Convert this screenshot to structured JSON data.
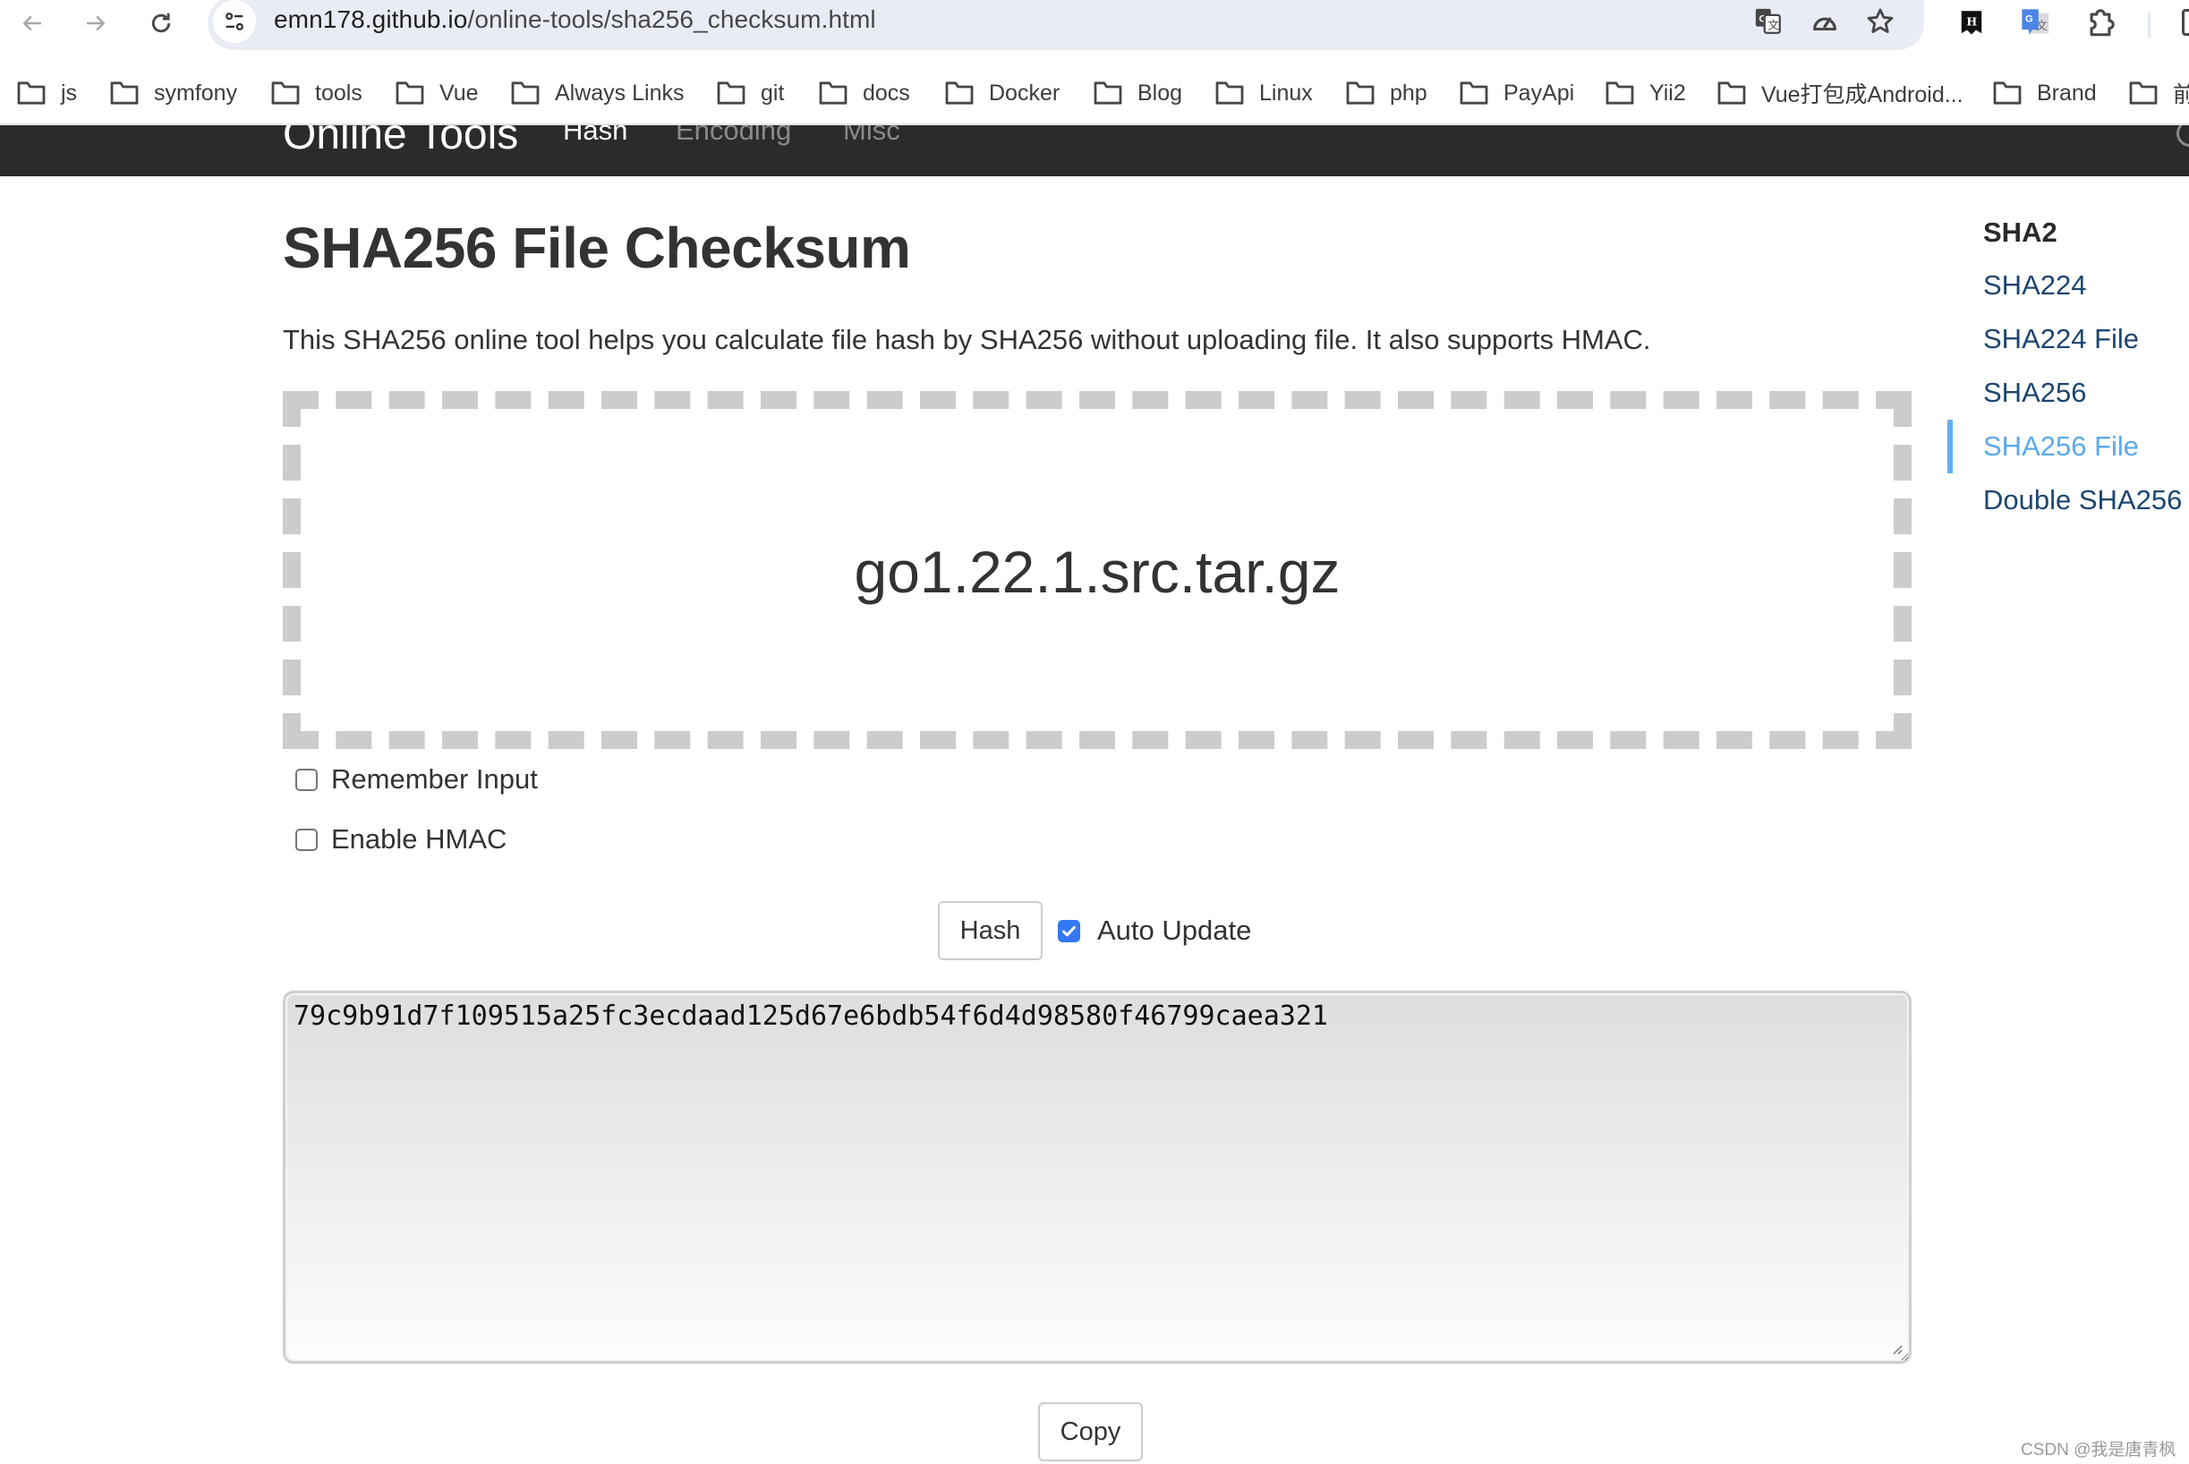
{
  "browser": {
    "url_host": "emn178.github.io",
    "url_path": "/online-tools/sha256_checksum.html",
    "toolbar_icons": [
      "back-icon",
      "forward-icon",
      "reload-icon",
      "site-info-icon",
      "translate-icon",
      "performance-icon",
      "bookmark-star-icon"
    ],
    "extensions": [
      "hexo-extension-icon",
      "google-translate-extension-icon",
      "extensions-puzzle-icon"
    ],
    "bookmarks": [
      {
        "label": "js"
      },
      {
        "label": "symfony"
      },
      {
        "label": "tools"
      },
      {
        "label": "Vue"
      },
      {
        "label": "Always Links"
      },
      {
        "label": "git"
      },
      {
        "label": "docs"
      },
      {
        "label": "Docker"
      },
      {
        "label": "Blog"
      },
      {
        "label": "Linux"
      },
      {
        "label": "php"
      },
      {
        "label": "PayApi"
      },
      {
        "label": "Yii2"
      },
      {
        "label": "Vue打包成Android..."
      },
      {
        "label": "Brand"
      },
      {
        "label": "前"
      }
    ]
  },
  "site_nav": {
    "brand": "Online Tools",
    "links": [
      {
        "label": "Hash",
        "active": true
      },
      {
        "label": "Encoding",
        "active": false
      },
      {
        "label": "Misc",
        "active": false
      }
    ]
  },
  "page": {
    "title": "SHA256 File Checksum",
    "description": "This SHA256 online tool helps you calculate file hash by SHA256 without uploading file. It also supports HMAC.",
    "dropzone_filename": "go1.22.1.src.tar.gz",
    "options": {
      "remember_input": {
        "label": "Remember Input",
        "checked": false
      },
      "enable_hmac": {
        "label": "Enable HMAC",
        "checked": false
      },
      "auto_update": {
        "label": "Auto Update",
        "checked": true
      }
    },
    "hash_button": "Hash",
    "output": "79c9b91d7f109515a25fc3ecdaad125d67e6bdb54f6d4d98580f46799caea321",
    "copy_button": "Copy"
  },
  "sidebar": {
    "heading": "SHA2",
    "items": [
      {
        "label": "SHA224",
        "active": false
      },
      {
        "label": "SHA224 File",
        "active": false
      },
      {
        "label": "SHA256",
        "active": false
      },
      {
        "label": "SHA256 File",
        "active": true
      },
      {
        "label": "Double SHA256",
        "active": false
      }
    ]
  },
  "watermark": "CSDN @我是唐青枫",
  "colors": {
    "navbar_bg": "#2b2b2b",
    "link": "#1c4670",
    "link_active": "#5aa9ea",
    "checkbox_checked": "#3478f6",
    "dropzone_border": "#cccccc"
  }
}
